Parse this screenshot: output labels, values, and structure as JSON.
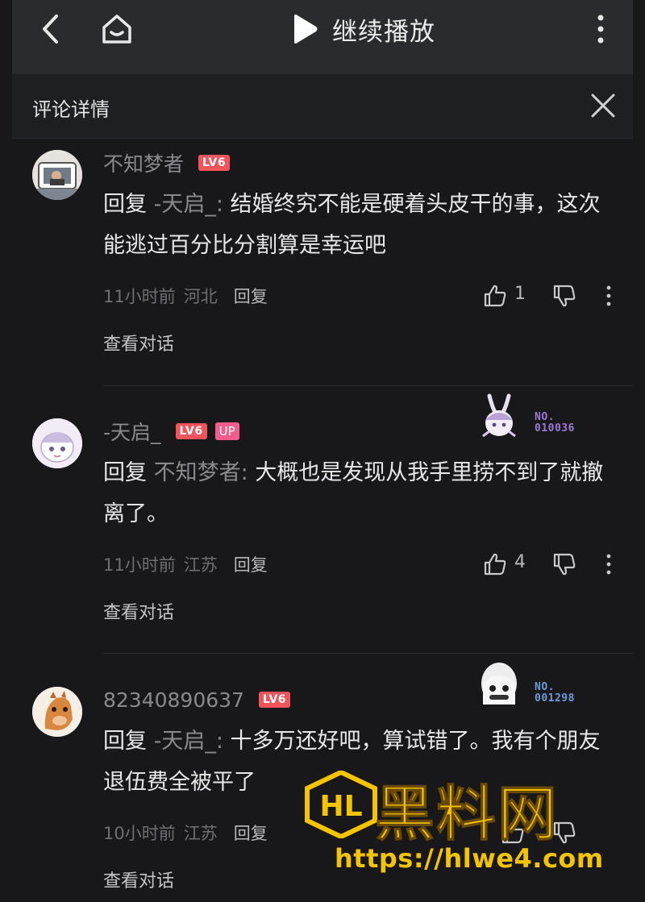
{
  "topbar": {
    "play_label": "继续播放"
  },
  "panel": {
    "title": "评论详情"
  },
  "comments": [
    {
      "username": "不知梦者",
      "level": "LV6",
      "reply_prefix": "回复 ",
      "reply_to": "-天启_:",
      "text": " 结婚终究不能是硬着头皮干的事，这次能逃过百分比分割算是幸运吧",
      "time": "11小时前",
      "location": "河北",
      "reply_label": "回复",
      "likes": "1",
      "view_conversation": "查看对话"
    },
    {
      "username": "-天启_",
      "level": "LV6",
      "up_badge": "UP",
      "decor_no_label": "NO.",
      "decor_no_value": "010036",
      "reply_prefix": "回复 ",
      "reply_to": "不知梦者:",
      "text": " 大概也是发现从我手里捞不到了就撤离了。",
      "time": "11小时前",
      "location": "江苏",
      "reply_label": "回复",
      "likes": "4",
      "view_conversation": "查看对话"
    },
    {
      "username": "82340890637",
      "level": "LV6",
      "decor_no_label": "NO.",
      "decor_no_value": "001298",
      "reply_prefix": "回复 ",
      "reply_to": "-天启_:",
      "text": " 十多万还好吧，算试错了。我有个朋友退伍费全被平了",
      "time": "10小时前",
      "location": "江苏",
      "reply_label": "回复",
      "view_conversation": "查看对话"
    }
  ],
  "watermark": {
    "logo_text": "HL",
    "title": "黑料网",
    "url": "https://hlwe4.com"
  },
  "colors": {
    "background": "#18181b",
    "topbar": "#2a2b2e",
    "level_badge": "#f2545b",
    "up_badge": "#f25d8e",
    "watermark": "#f5c400"
  },
  "icons": [
    "back-icon",
    "home-icon",
    "play-icon",
    "more-vertical-icon",
    "close-icon",
    "like-icon",
    "dislike-icon",
    "comment-more-icon"
  ]
}
